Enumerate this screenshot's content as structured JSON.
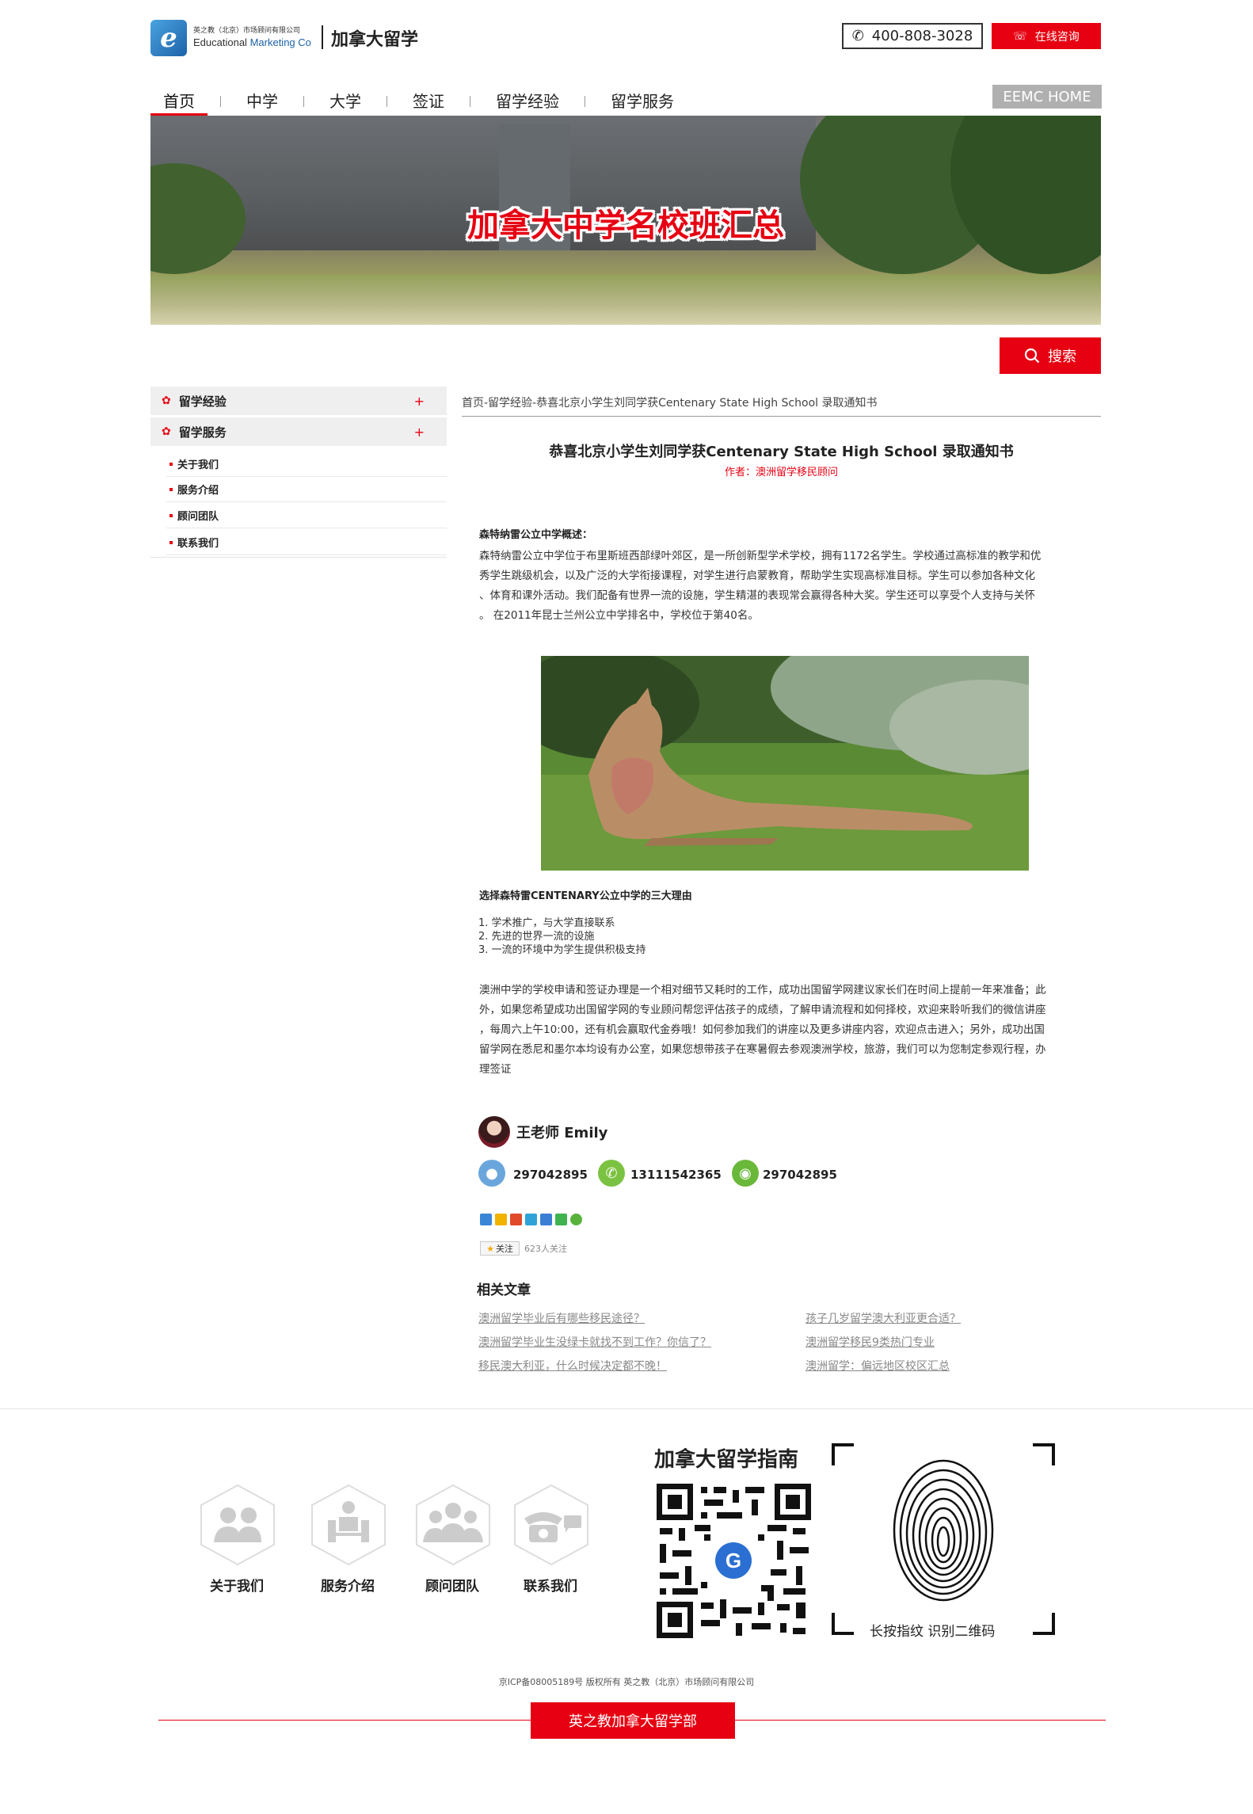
{
  "header": {
    "logo_cn": "英之教（北京）市场顾问有限公司",
    "logo_en_1": "Educational",
    "logo_en_2": "Marketing Co",
    "site_name": "加拿大留学",
    "phone": "400-808-3028",
    "consult_label": "在线咨询"
  },
  "nav": {
    "items": [
      "首页",
      "中学",
      "大学",
      "签证",
      "留学经验",
      "留学服务"
    ],
    "active": "首页",
    "eemc_home": "EEMC HOME"
  },
  "banner": {
    "title": "加拿大中学名校班汇总"
  },
  "search": {
    "placeholder": "",
    "button_label": "搜索"
  },
  "sidebar": {
    "categories": [
      "留学经验",
      "留学服务"
    ],
    "sub_items": [
      "关于我们",
      "服务介绍",
      "顾问团队",
      "联系我们"
    ]
  },
  "article": {
    "breadcrumb": "首页-留学经验-恭喜北京小学生刘同学获Centenary State High School 录取通知书",
    "title": "恭喜北京小学生刘同学获Centenary State High School 录取通知书",
    "author": "作者：澳洲留学移民顾问",
    "section1_head": "森特纳雷公立中学概述：",
    "section1_lines": [
      "森特纳雷公立中学位于布里斯班西部绿叶郊区，是一所创新型学术学校，拥有1172名学生。学校通过高标准的教学和优",
      "秀学生跳级机会，以及广泛的大学衔接课程，对学生进行启蒙教育，帮助学生实现高标准目标。学生可以参加各种文化",
      "、体育和课外活动。我们配备有世界一流的设施，学生精湛的表现常会赢得各种大奖。学生还可以享受个人支持与关怀",
      "。 在2011年昆士兰州公立中学排名中，学校位于第40名。"
    ],
    "section2_head": "选择森特雷CENTENARY公立中学的三大理由",
    "reasons": [
      "1. 学术推广，与大学直接联系",
      "2. 先进的世界一流的设施",
      "3. 一流的环境中为学生提供积极支持"
    ],
    "closing_lines": [
      "澳洲中学的学校申请和签证办理是一个相对细节又耗时的工作，成功出国留学网建议家长们在时间上提前一年来准备；此",
      "外，如果您希望成功出国留学网的专业顾问帮您评估孩子的成绩，了解申请流程和如何择校，欢迎来聆听我们的微信讲座",
      "，每周六上午10:00，还有机会赢取代金券哦！如何参加我们的讲座以及更多讲座内容，欢迎点击进入；另外，成功出国",
      "留学网在悉尼和墨尔本均设有办公室，如果您想带孩子在寒暑假去参观澳洲学校，旅游，我们可以为您制定参观行程，办",
      "理签证"
    ]
  },
  "consultant": {
    "name": "王老师 Emily",
    "qq": "297042895",
    "whatsapp": "13111542365",
    "wechat": "297042895"
  },
  "share": {
    "follow_label": "关注",
    "follow_count": "623人关注"
  },
  "related": {
    "title": "相关文章",
    "left": [
      "澳洲留学毕业后有哪些移民途径？",
      "澳洲留学毕业生没绿卡就找不到工作？你信了？",
      "移民澳大利亚，什么时候决定都不晚！"
    ],
    "right": [
      "孩子几岁留学澳大利亚更合适？",
      "澳洲留学移民9类热门专业",
      "澳洲留学：偏远地区校区汇总"
    ]
  },
  "footer": {
    "links": [
      "关于我们",
      "服务介绍",
      "顾问团队",
      "联系我们"
    ],
    "guide_title": "加拿大留学指南",
    "qr_caption": "长按指纹 识别二维码",
    "icp": "京ICP备08005189号 版权所有 英之教（北京）市场顾问有限公司",
    "button_label": "英之教加拿大留学部"
  },
  "colors": {
    "accent": "#e60012",
    "nav_home_bg": "#b0b0b0",
    "sidebar_bg": "#efefef"
  }
}
